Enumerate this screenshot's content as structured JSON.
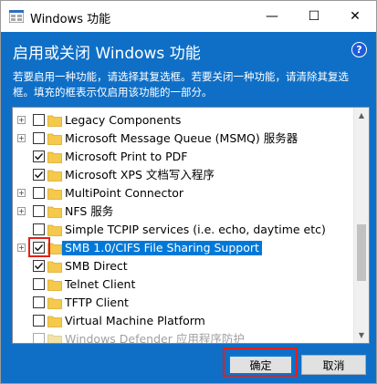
{
  "window": {
    "title": "Windows 功能",
    "minimize_glyph": "—",
    "maximize_glyph": "☐",
    "close_glyph": "✕"
  },
  "header": {
    "heading": "启用或关闭 Windows 功能",
    "help_glyph": "?",
    "description": "若要启用一种功能，请选择其复选框。若要关闭一种功能，请清除其复选框。填充的框表示仅启用该功能的一部分。"
  },
  "features": [
    {
      "label": "Legacy Components",
      "expandable": true,
      "checked": false,
      "selected": false,
      "disabled": false
    },
    {
      "label": "Microsoft Message Queue (MSMQ) 服务器",
      "expandable": true,
      "checked": false,
      "selected": false,
      "disabled": false
    },
    {
      "label": "Microsoft Print to PDF",
      "expandable": false,
      "checked": true,
      "selected": false,
      "disabled": false
    },
    {
      "label": "Microsoft XPS 文档写入程序",
      "expandable": false,
      "checked": true,
      "selected": false,
      "disabled": false
    },
    {
      "label": "MultiPoint Connector",
      "expandable": true,
      "checked": false,
      "selected": false,
      "disabled": false
    },
    {
      "label": "NFS 服务",
      "expandable": true,
      "checked": false,
      "selected": false,
      "disabled": false
    },
    {
      "label": "Simple TCPIP services (i.e. echo, daytime etc)",
      "expandable": false,
      "checked": false,
      "selected": false,
      "disabled": false
    },
    {
      "label": "SMB 1.0/CIFS File Sharing Support",
      "expandable": true,
      "checked": true,
      "selected": true,
      "disabled": false
    },
    {
      "label": "SMB Direct",
      "expandable": false,
      "checked": true,
      "selected": false,
      "disabled": false
    },
    {
      "label": "Telnet Client",
      "expandable": false,
      "checked": false,
      "selected": false,
      "disabled": false
    },
    {
      "label": "TFTP Client",
      "expandable": false,
      "checked": false,
      "selected": false,
      "disabled": false
    },
    {
      "label": "Virtual Machine Platform",
      "expandable": false,
      "checked": false,
      "selected": false,
      "disabled": false
    },
    {
      "label": "Windows Defender 应用程序防护",
      "expandable": false,
      "checked": false,
      "selected": false,
      "disabled": true
    }
  ],
  "buttons": {
    "ok_label": "确定",
    "cancel_label": "取消"
  },
  "colors": {
    "accent_blue": "#0f6fc6",
    "selection_blue": "#0078d7",
    "highlight_red": "#e0201b",
    "folder_yellow": "#f4c94c"
  },
  "icons": {
    "expander": "plus-icon",
    "folder": "folder-icon",
    "check": "checkmark-icon",
    "help": "help-icon",
    "scroll_up": "▲",
    "scroll_down": "▼"
  }
}
